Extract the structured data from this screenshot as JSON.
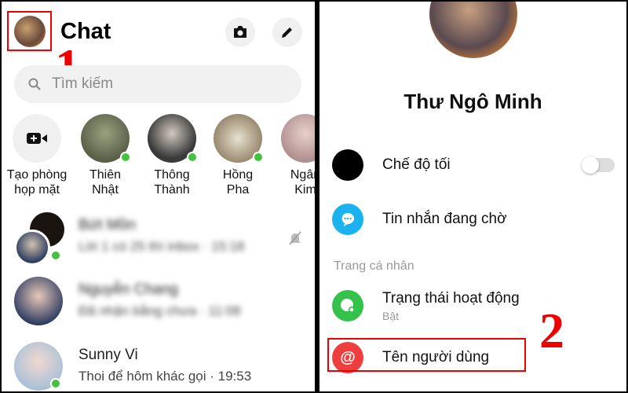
{
  "left": {
    "title": "Chat",
    "search_placeholder": "Tìm kiếm",
    "annotation": "1",
    "stories": [
      {
        "label": "Tạo phòng\nhọp mặt"
      },
      {
        "label": "Thiên\nNhật"
      },
      {
        "label": "Thông\nThành"
      },
      {
        "label": "Hồng\nPha"
      },
      {
        "label": "Ngân\nKim"
      }
    ],
    "chats": [
      {
        "name": "Bứt Mồn",
        "message": "Lời 1 có 25 thì inbox · 15:18",
        "blurred": true
      },
      {
        "name": "Nguyễn Chang",
        "message": "Đã nhận bằng chưa · 11:08",
        "blurred": true
      },
      {
        "name": "Sunny Vi",
        "message": "Thoi để hôm khác gọi · 19:53",
        "blurred": false
      }
    ]
  },
  "right": {
    "profile_name": "Thư Ngô Minh",
    "dark_mode": {
      "label": "Chế độ tối",
      "on": false
    },
    "message_requests": "Tin nhắn đang chờ",
    "section": "Trang cá nhân",
    "active_status": {
      "label": "Trạng thái hoạt động",
      "value": "Bật"
    },
    "username": "Tên người dùng",
    "annotation": "2"
  },
  "colors": {
    "online": "#44c23e",
    "highlight": "#e00000",
    "messages_icon": "#1ab3f0",
    "active_icon": "#35c24a",
    "username_icon": "#ef3e3e"
  }
}
